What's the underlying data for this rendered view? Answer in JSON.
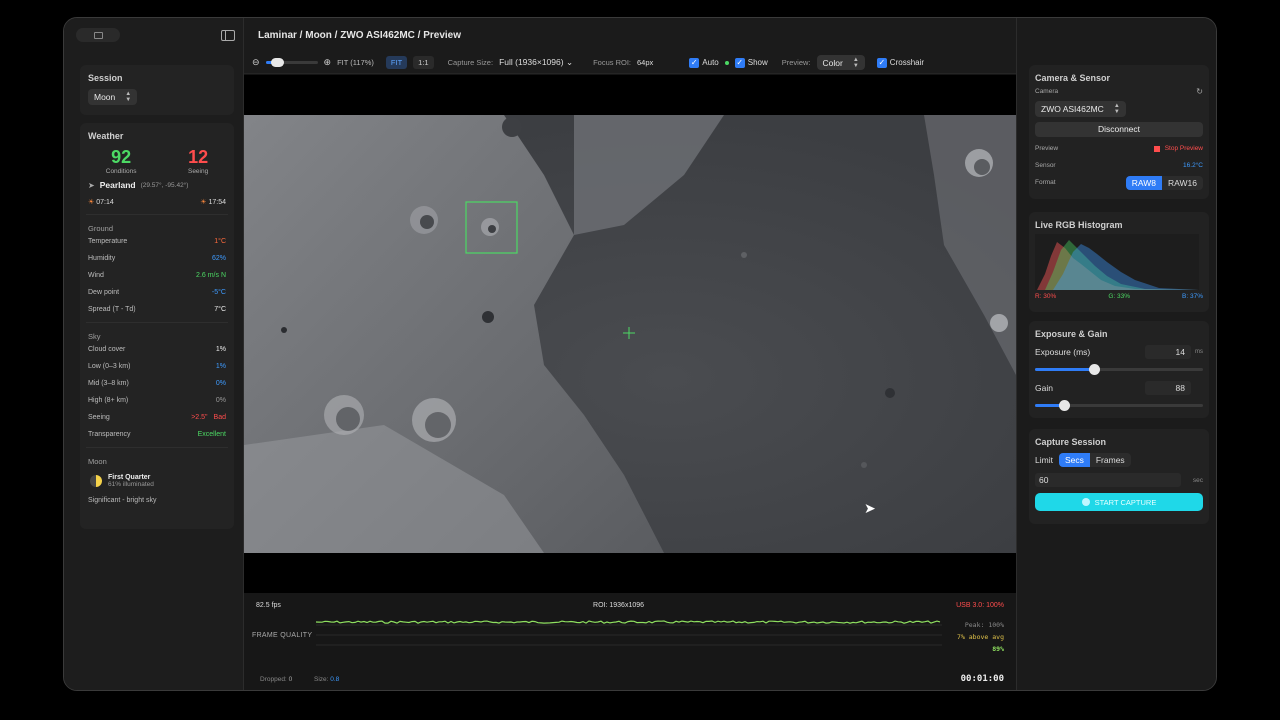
{
  "breadcrumb": "Laminar / Moon / ZWO ASI462MC / Preview",
  "toolbar": {
    "zoom_label": "FIT (117%)",
    "fit": "FIT",
    "one_to_one": "1:1",
    "capture_size_label": "Capture Size:",
    "capture_size_value": "Full (1936×1096)",
    "focus_roi_label": "Focus ROI:",
    "focus_roi_value": "64px",
    "auto": "Auto",
    "show": "Show",
    "preview_label": "Preview:",
    "preview_value": "Color",
    "crosshair": "Crosshair",
    "zoom_level": 0.2
  },
  "session": {
    "title": "Session",
    "value": "Moon"
  },
  "weather": {
    "title": "Weather",
    "conditions_value": "92",
    "conditions_label": "Conditions",
    "seeing_value": "12",
    "seeing_label": "Seeing",
    "location": "Pearland",
    "coords": "(29.57°, -95.42°)",
    "sunrise": "07:14",
    "sunset": "17:54",
    "ground_title": "Ground",
    "ground": [
      {
        "label": "Temperature",
        "value": "1°C",
        "color": "orange"
      },
      {
        "label": "Humidity",
        "value": "62%",
        "color": "blue"
      },
      {
        "label": "Wind",
        "value": "2.6 m/s N",
        "color": "green"
      },
      {
        "label": "Dew point",
        "value": "-5°C",
        "color": "blue"
      },
      {
        "label": "Spread (T - Td)",
        "value": "7°C",
        "color": "white"
      }
    ],
    "sky_title": "Sky",
    "sky": [
      {
        "label": "Cloud cover",
        "value": "1%",
        "color": "white"
      },
      {
        "label": "Low (0–3 km)",
        "value": "1%",
        "color": "blue"
      },
      {
        "label": "Mid (3–8 km)",
        "value": "0%",
        "color": "blue"
      },
      {
        "label": "High (8+ km)",
        "value": "0%",
        "color": "gray"
      },
      {
        "label": "Seeing",
        "value": ">2.5\"",
        "value2": "Bad",
        "color": "red"
      },
      {
        "label": "Transparency",
        "value": "Excellent",
        "color": "green"
      }
    ],
    "moon_title": "Moon",
    "moon_phase": "First Quarter",
    "moon_illum": "61% illuminated",
    "moon_note": "Significant - bright sky"
  },
  "stats": {
    "fps": "82.5 fps",
    "roi": "ROI: 1936x1096",
    "usb": "USB 3.0: 100%",
    "frame_quality": "FRAME QUALITY",
    "peak": "Peak: 100%",
    "above_avg": "7% above avg",
    "pct": "89%",
    "dropped_label": "Dropped:",
    "dropped_value": "0",
    "size_label": "Size:",
    "size_value": "0.8",
    "timer": "00:01:00"
  },
  "camera": {
    "title": "Camera & Sensor",
    "camera_label": "Camera",
    "camera_value": "ZWO ASI462MC",
    "disconnect": "Disconnect",
    "preview_label": "Preview",
    "stop_preview": "Stop Preview",
    "sensor_label": "Sensor",
    "sensor_value": "16.2°C",
    "format_label": "Format",
    "raw8": "RAW8",
    "raw16": "RAW16"
  },
  "histogram": {
    "title": "Live RGB Histogram",
    "r": "R: 30%",
    "g": "G: 33%",
    "b": "B: 37%"
  },
  "exposure": {
    "title": "Exposure & Gain",
    "exposure_label": "Exposure (ms)",
    "exposure_value": "14",
    "exposure_unit": "ms",
    "gain_label": "Gain",
    "gain_value": "88",
    "exposure_level": 0.35,
    "gain_level": 0.17
  },
  "capture": {
    "title": "Capture Session",
    "limit_label": "Limit",
    "secs": "Secs",
    "frames": "Frames",
    "value": "60",
    "unit": "sec",
    "start": "START CAPTURE"
  }
}
